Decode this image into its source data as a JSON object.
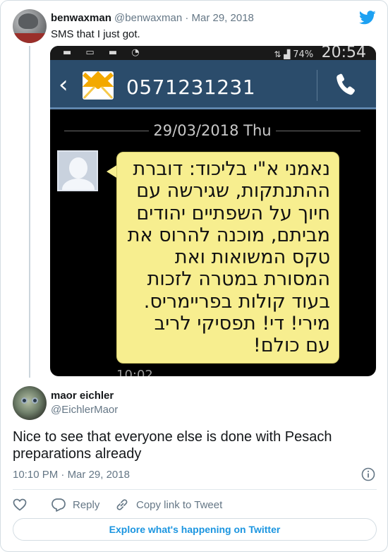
{
  "parent_tweet": {
    "author_name": "benwaxman",
    "author_handle": "@benwaxman",
    "separator": "·",
    "date": "Mar 29, 2018",
    "text": "SMS that I just got."
  },
  "sms_screenshot": {
    "status_battery": "74%",
    "status_time": "20:54",
    "sender_number": "0571231231",
    "date_label": "29/03/2018 Thu",
    "message_lines": [
      "נאמני א\"י בליכוד: דוברת",
      "ההתנתקות, שגירשה עם",
      "חיוך על השפתיים יהודים",
      "מביתם, מוכנה להרוס את",
      "טקס המשואות ואת",
      "המסורת במטרה לזכות",
      "בעוד קולות בפריימריס.",
      "מירי! די! תפסיקי לריב",
      "עם כולם!"
    ],
    "message_time": "10:02"
  },
  "reply_tweet": {
    "author_name": "maor eichler",
    "author_handle": "@EichlerMaor",
    "text": "Nice to see that everyone else is done with Pesach preparations already",
    "time": "10:10 PM",
    "separator": "·",
    "date": "Mar 29, 2018"
  },
  "actions": {
    "reply_label": "Reply",
    "copy_link_label": "Copy link to Tweet"
  },
  "explore_label": "Explore what's happening on Twitter",
  "colors": {
    "twitter_blue": "#1da1f2",
    "link_blue": "#1b95e0",
    "sms_header": "#2b4c6b",
    "bubble": "#f7ee8f"
  },
  "icons": [
    "twitter-logo-icon",
    "heart-icon",
    "reply-icon",
    "link-icon",
    "info-icon",
    "back-chevron-icon",
    "envelope-icon",
    "phone-call-icon"
  ]
}
